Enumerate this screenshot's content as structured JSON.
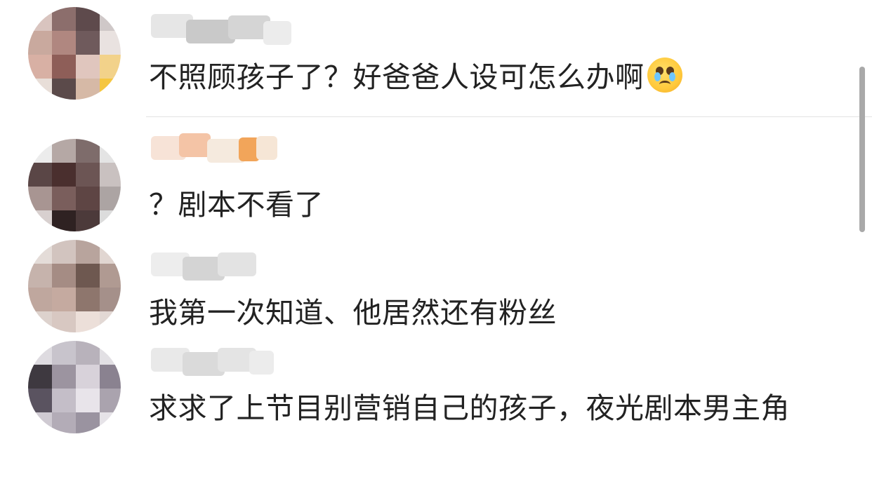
{
  "comments": [
    {
      "text": "不照顾孩子了？好爸爸人设可怎么办啊",
      "emoji": "pleading-crying-face"
    },
    {
      "text": "？剧本不看了"
    },
    {
      "text": "我第一次知道、他居然还有粉丝"
    },
    {
      "text": "求求了上节目别营销自己的孩子，夜光剧本男主角"
    }
  ],
  "colors": {
    "text": "#222222",
    "divider": "#e2e2e2",
    "scrollbar": "#a9a9a9"
  }
}
